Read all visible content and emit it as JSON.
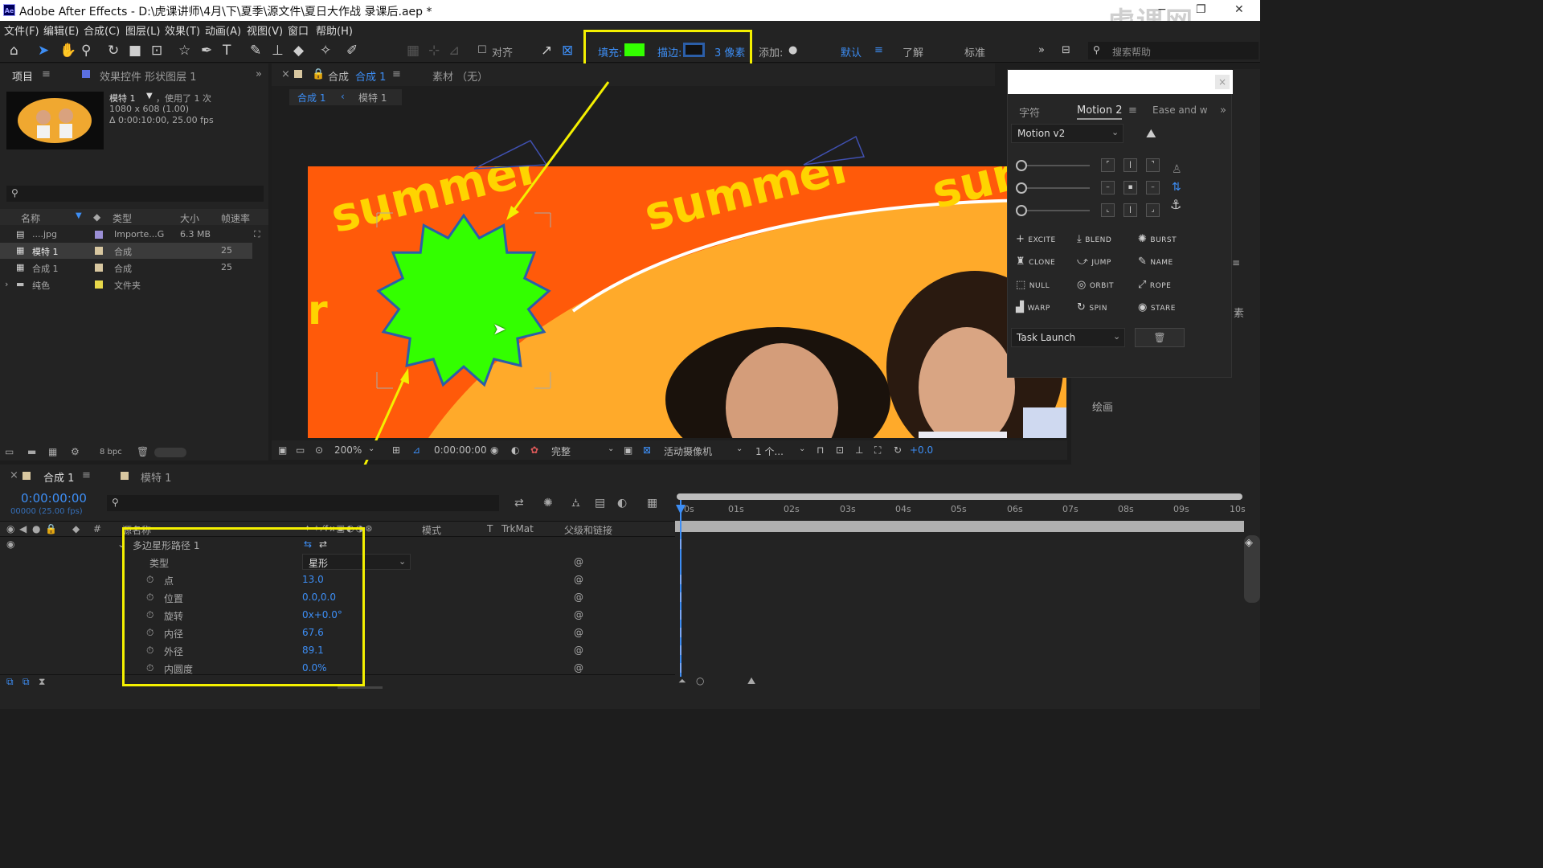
{
  "window": {
    "app_icon": "Ae",
    "title": "Adobe After Effects - D:\\虎课讲师\\4月\\下\\夏季\\源文件\\夏日大作战 录课后.aep *",
    "watermark": "虎课网",
    "buttons": [
      "−",
      "❐",
      "✕"
    ]
  },
  "menu": [
    "文件(F)",
    "编辑(E)",
    "合成(C)",
    "图层(L)",
    "效果(T)",
    "动画(A)",
    "视图(V)",
    "窗口",
    "帮助(H)"
  ],
  "toolbar": {
    "align_label": "对齐",
    "fill_label": "填充:",
    "stroke_label": "描边:",
    "stroke_width": "3 像素",
    "add_label": "添加:",
    "workspaces": [
      "默认",
      "了解",
      "标准"
    ],
    "search_placeholder": "搜索帮助",
    "fill_color": "#33ff00",
    "stroke_color": "#2b5ea8"
  },
  "project_panel": {
    "tabs": [
      "项目",
      "效果控件 形状图层 1"
    ],
    "selected_name": "模特 1",
    "selected_usage": "，使用了 1 次",
    "selected_size": "1080 x 608 (1.00)",
    "selected_duration": "Δ 0:00:10:00, 25.00 fps",
    "columns": [
      "名称",
      "类型",
      "大小",
      "帧速率"
    ],
    "items": [
      {
        "name": "....jpg",
        "type": "Importe...G",
        "size": "6.3 MB",
        "fps": "",
        "color": "#9b8fd6"
      },
      {
        "name": "模特 1",
        "type": "合成",
        "size": "",
        "fps": "25",
        "color": "#d8c7a0"
      },
      {
        "name": "合成 1",
        "type": "合成",
        "size": "",
        "fps": "25",
        "color": "#d8c7a0"
      },
      {
        "name": "纯色",
        "type": "文件夹",
        "size": "",
        "fps": "",
        "color": "#e8d84a"
      }
    ],
    "bpc": "8 bpc"
  },
  "comp_panel": {
    "tab_title": "合成",
    "tab_comp": "合成 1",
    "footage_tab": "素材 （无）",
    "breadcrumb": [
      "合成 1",
      "模特 1"
    ],
    "canvas_text": [
      "summer",
      "summer",
      "sur",
      "r"
    ],
    "zoom": "200%",
    "timecode": "0:00:00:00",
    "quality": "完整",
    "camera": "活动摄像机",
    "views": "1 个...",
    "exposure": "+0.0"
  },
  "motion_panel": {
    "tabs": [
      "字符",
      "Motion 2",
      "Ease and w"
    ],
    "version_select": "Motion v2",
    "buttons": [
      "EXCITE",
      "BLEND",
      "BURST",
      "CLONE",
      "JUMP",
      "NAME",
      "NULL",
      "ORBIT",
      "ROPE",
      "WARP",
      "SPIN",
      "STARE"
    ],
    "task_select": "Task Launch",
    "side_label_1": "素",
    "side_label_2": "绘画"
  },
  "timeline": {
    "tabs": [
      "合成 1",
      "模特 1"
    ],
    "timecode": "0:00:00:00",
    "frame_info": "00000 (25.00 fps)",
    "columns": [
      "源名称",
      "模式",
      "T",
      "TrkMat",
      "父级和链接"
    ],
    "group_name": "多边星形路径 1",
    "properties": [
      {
        "name": "类型",
        "value": "星形"
      },
      {
        "name": "点",
        "value": "13.0"
      },
      {
        "name": "位置",
        "value": "0.0,0.0"
      },
      {
        "name": "旋转",
        "value": "0x+0.0°"
      },
      {
        "name": "内径",
        "value": "67.6"
      },
      {
        "name": "外径",
        "value": "89.1"
      },
      {
        "name": "内圆度",
        "value": "0.0%"
      }
    ],
    "ruler": [
      "0s",
      "01s",
      "02s",
      "03s",
      "04s",
      "05s",
      "06s",
      "07s",
      "08s",
      "09s",
      "10s"
    ]
  }
}
